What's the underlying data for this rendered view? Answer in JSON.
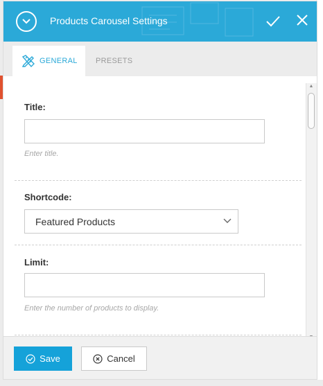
{
  "dialog": {
    "title": "Products Carousel Settings",
    "accent_color": "#2ba9d8"
  },
  "tabs": [
    {
      "label": "GENERAL",
      "icon": "pencil-ruler-icon",
      "active": true
    },
    {
      "label": "PRESETS",
      "active": false
    }
  ],
  "fields": {
    "title": {
      "label": "Title:",
      "value": "",
      "help": "Enter title."
    },
    "shortcode": {
      "label": "Shortcode:",
      "selected": "Featured Products"
    },
    "limit": {
      "label": "Limit:",
      "value": "",
      "help": "Enter the number of products to display."
    }
  },
  "footer": {
    "save_label": "Save",
    "cancel_label": "Cancel"
  }
}
